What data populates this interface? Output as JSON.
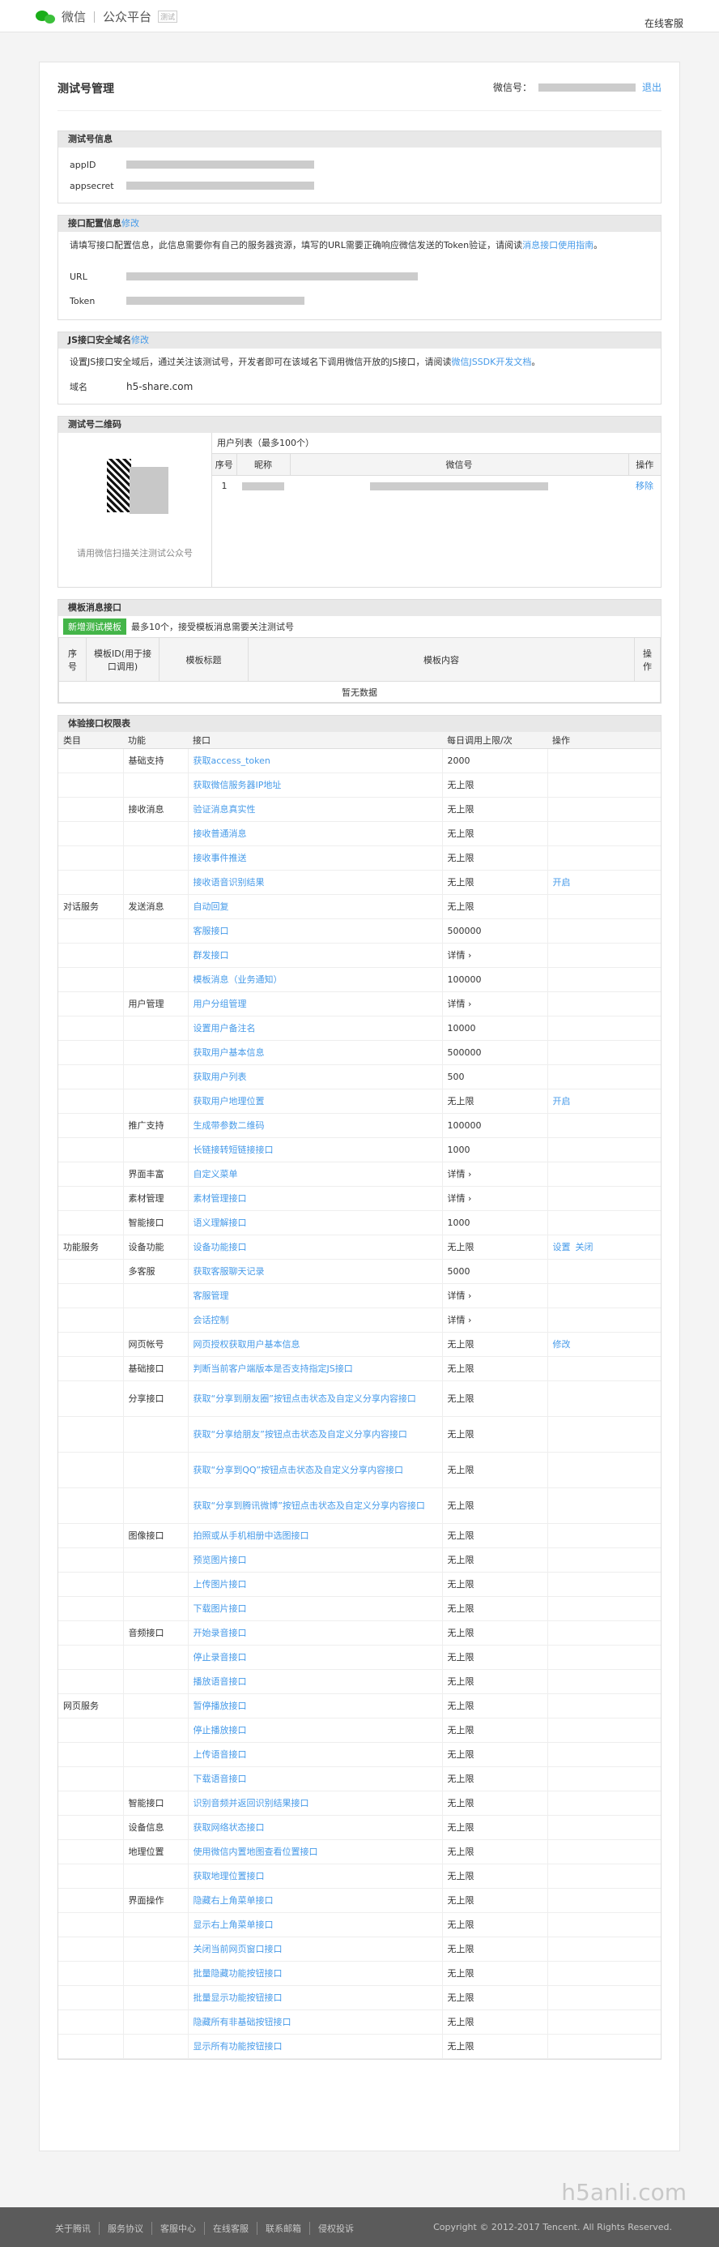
{
  "topbar": {
    "logo_text": "微信",
    "logo_sub": "公众平台",
    "logo_tag": "测试",
    "help": "在线客服"
  },
  "page": {
    "title": "测试号管理",
    "account_label": "微信号：",
    "logout": "退出"
  },
  "test_account": {
    "title": "测试号信息",
    "appid_label": "appID",
    "appsecret_label": "appsecret"
  },
  "api_config": {
    "title": "接口配置信息",
    "edit": "修改",
    "desc_1": "请填写接口配置信息，此信息需要你有自己的服务器资源，填写的URL需要正确响应微信发送的Token验证，请阅读",
    "desc_link": "消息接口使用指南",
    "desc_2": "。",
    "url_label": "URL",
    "token_label": "Token"
  },
  "js_domain": {
    "title": "JS接口安全域名",
    "edit": "修改",
    "desc_1": "设置JS接口安全域后，通过关注该测试号，开发者即可在该域名下调用微信开放的JS接口，请阅读",
    "desc_link": "微信JSSDK开发文档",
    "desc_2": "。",
    "domain_label": "域名",
    "domain_value": "h5-share.com"
  },
  "qrcode": {
    "title": "测试号二维码",
    "hint": "请用微信扫描关注测试公众号",
    "user_list_title": "用户列表（最多100个）",
    "columns": [
      "序号",
      "昵称",
      "微信号",
      "操作"
    ],
    "rows": [
      {
        "index": "1",
        "action": "移除"
      }
    ]
  },
  "template": {
    "title": "模板消息接口",
    "new_button": "新增测试模板",
    "note": "最多10个，接受模板消息需要关注测试号",
    "columns": [
      "序号",
      "模板ID(用于接口调用)",
      "模板标题",
      "模板内容",
      "操作"
    ],
    "empty": "暂无数据"
  },
  "permissions": {
    "title": "体验接口权限表",
    "columns": [
      "类目",
      "功能",
      "接口",
      "每日调用上限/次",
      "操作"
    ],
    "rows": [
      {
        "cat": "",
        "fn": "基础支持",
        "iface": "获取access_token",
        "limit": "2000",
        "ops": []
      },
      {
        "cat": "",
        "fn": "",
        "iface": "获取微信服务器IP地址",
        "limit": "无上限",
        "ops": []
      },
      {
        "cat": "",
        "fn": "接收消息",
        "iface": "验证消息真实性",
        "limit": "无上限",
        "ops": []
      },
      {
        "cat": "",
        "fn": "",
        "iface": "接收普通消息",
        "limit": "无上限",
        "ops": []
      },
      {
        "cat": "",
        "fn": "",
        "iface": "接收事件推送",
        "limit": "无上限",
        "ops": []
      },
      {
        "cat": "",
        "fn": "",
        "iface": "接收语音识别结果",
        "limit": "无上限",
        "ops": [
          "开启"
        ]
      },
      {
        "cat": "对话服务",
        "fn": "发送消息",
        "iface": "自动回复",
        "limit": "无上限",
        "ops": []
      },
      {
        "cat": "",
        "fn": "",
        "iface": "客服接口",
        "limit": "500000",
        "ops": []
      },
      {
        "cat": "",
        "fn": "",
        "iface": "群发接口",
        "limit": "详情 ›",
        "ops": []
      },
      {
        "cat": "",
        "fn": "",
        "iface": "模板消息（业务通知）",
        "limit": "100000",
        "ops": []
      },
      {
        "cat": "",
        "fn": "用户管理",
        "iface": "用户分组管理",
        "limit": "详情 ›",
        "ops": []
      },
      {
        "cat": "",
        "fn": "",
        "iface": "设置用户备注名",
        "limit": "10000",
        "ops": []
      },
      {
        "cat": "",
        "fn": "",
        "iface": "获取用户基本信息",
        "limit": "500000",
        "ops": []
      },
      {
        "cat": "",
        "fn": "",
        "iface": "获取用户列表",
        "limit": "500",
        "ops": []
      },
      {
        "cat": "",
        "fn": "",
        "iface": "获取用户地理位置",
        "limit": "无上限",
        "ops": [
          "开启"
        ]
      },
      {
        "cat": "",
        "fn": "推广支持",
        "iface": "生成带参数二维码",
        "limit": "100000",
        "ops": []
      },
      {
        "cat": "",
        "fn": "",
        "iface": "长链接转短链接接口",
        "limit": "1000",
        "ops": []
      },
      {
        "cat": "",
        "fn": "界面丰富",
        "iface": "自定义菜单",
        "limit": "详情 ›",
        "ops": []
      },
      {
        "cat": "",
        "fn": "素材管理",
        "iface": "素材管理接口",
        "limit": "详情 ›",
        "ops": []
      },
      {
        "cat": "",
        "fn": "智能接口",
        "iface": "语义理解接口",
        "limit": "1000",
        "ops": []
      },
      {
        "cat": "功能服务",
        "fn": "设备功能",
        "iface": "设备功能接口",
        "limit": "无上限",
        "ops": [
          "设置",
          "关闭"
        ]
      },
      {
        "cat": "",
        "fn": "多客服",
        "iface": "获取客服聊天记录",
        "limit": "5000",
        "ops": []
      },
      {
        "cat": "",
        "fn": "",
        "iface": "客服管理",
        "limit": "详情 ›",
        "ops": []
      },
      {
        "cat": "",
        "fn": "",
        "iface": "会话控制",
        "limit": "详情 ›",
        "ops": []
      },
      {
        "cat": "",
        "fn": "网页帐号",
        "iface": "网页授权获取用户基本信息",
        "limit": "无上限",
        "ops": [
          "修改"
        ]
      },
      {
        "cat": "",
        "fn": "基础接口",
        "iface": "判断当前客户端版本是否支持指定JS接口",
        "limit": "无上限",
        "ops": []
      },
      {
        "cat": "",
        "fn": "分享接口",
        "iface": "获取“分享到朋友圈”按钮点击状态及自定义分享内容接口",
        "limit": "无上限",
        "ops": []
      },
      {
        "cat": "",
        "fn": "",
        "iface": "获取“分享给朋友”按钮点击状态及自定义分享内容接口",
        "limit": "无上限",
        "ops": []
      },
      {
        "cat": "",
        "fn": "",
        "iface": "获取“分享到QQ”按钮点击状态及自定义分享内容接口",
        "limit": "无上限",
        "ops": []
      },
      {
        "cat": "",
        "fn": "",
        "iface": "获取“分享到腾讯微博”按钮点击状态及自定义分享内容接口",
        "limit": "无上限",
        "ops": []
      },
      {
        "cat": "",
        "fn": "图像接口",
        "iface": "拍照或从手机相册中选图接口",
        "limit": "无上限",
        "ops": []
      },
      {
        "cat": "",
        "fn": "",
        "iface": "预览图片接口",
        "limit": "无上限",
        "ops": []
      },
      {
        "cat": "",
        "fn": "",
        "iface": "上传图片接口",
        "limit": "无上限",
        "ops": []
      },
      {
        "cat": "",
        "fn": "",
        "iface": "下载图片接口",
        "limit": "无上限",
        "ops": []
      },
      {
        "cat": "",
        "fn": "音频接口",
        "iface": "开始录音接口",
        "limit": "无上限",
        "ops": []
      },
      {
        "cat": "",
        "fn": "",
        "iface": "停止录音接口",
        "limit": "无上限",
        "ops": []
      },
      {
        "cat": "",
        "fn": "",
        "iface": "播放语音接口",
        "limit": "无上限",
        "ops": []
      },
      {
        "cat": "网页服务",
        "fn": "",
        "iface": "暂停播放接口",
        "limit": "无上限",
        "ops": []
      },
      {
        "cat": "",
        "fn": "",
        "iface": "停止播放接口",
        "limit": "无上限",
        "ops": []
      },
      {
        "cat": "",
        "fn": "",
        "iface": "上传语音接口",
        "limit": "无上限",
        "ops": []
      },
      {
        "cat": "",
        "fn": "",
        "iface": "下载语音接口",
        "limit": "无上限",
        "ops": []
      },
      {
        "cat": "",
        "fn": "智能接口",
        "iface": "识别音频并返回识别结果接口",
        "limit": "无上限",
        "ops": []
      },
      {
        "cat": "",
        "fn": "设备信息",
        "iface": "获取网络状态接口",
        "limit": "无上限",
        "ops": []
      },
      {
        "cat": "",
        "fn": "地理位置",
        "iface": "使用微信内置地图查看位置接口",
        "limit": "无上限",
        "ops": []
      },
      {
        "cat": "",
        "fn": "",
        "iface": "获取地理位置接口",
        "limit": "无上限",
        "ops": []
      },
      {
        "cat": "",
        "fn": "界面操作",
        "iface": "隐藏右上角菜单接口",
        "limit": "无上限",
        "ops": []
      },
      {
        "cat": "",
        "fn": "",
        "iface": "显示右上角菜单接口",
        "limit": "无上限",
        "ops": []
      },
      {
        "cat": "",
        "fn": "",
        "iface": "关闭当前网页窗口接口",
        "limit": "无上限",
        "ops": []
      },
      {
        "cat": "",
        "fn": "",
        "iface": "批量隐藏功能按钮接口",
        "limit": "无上限",
        "ops": []
      },
      {
        "cat": "",
        "fn": "",
        "iface": "批量显示功能按钮接口",
        "limit": "无上限",
        "ops": []
      },
      {
        "cat": "",
        "fn": "",
        "iface": "隐藏所有非基础按钮接口",
        "limit": "无上限",
        "ops": []
      },
      {
        "cat": "",
        "fn": "",
        "iface": "显示所有功能按钮接口",
        "limit": "无上限",
        "ops": []
      }
    ]
  },
  "footer": {
    "links": [
      "关于腾讯",
      "服务协议",
      "客服中心",
      "在线客服",
      "联系邮箱",
      "侵权投诉"
    ],
    "copyright": "Copyright © 2012-2017 Tencent. All Rights Reserved."
  },
  "watermark": "h5anli.com",
  "colors": {
    "link": "#459ae9",
    "green": "#44b549",
    "footer": "#5b5b5b"
  }
}
